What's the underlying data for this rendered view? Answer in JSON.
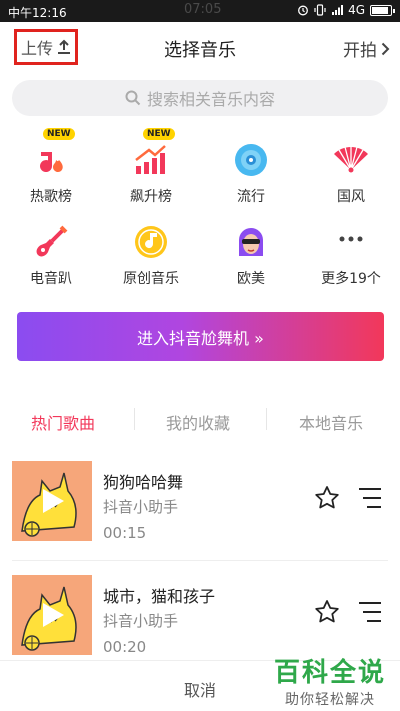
{
  "status_bar": {
    "time": "中午12:16",
    "center_text": "07:05",
    "network": "4G",
    "battery_level": 0.8
  },
  "header": {
    "upload_label": "上传",
    "title": "选择音乐",
    "start_label": "开拍"
  },
  "search": {
    "placeholder": "搜索相关音乐内容"
  },
  "categories": [
    {
      "label": "热歌榜",
      "icon": "hot-chart-icon",
      "badge": "NEW"
    },
    {
      "label": "飙升榜",
      "icon": "rising-chart-icon",
      "badge": "NEW"
    },
    {
      "label": "流行",
      "icon": "vinyl-icon",
      "badge": ""
    },
    {
      "label": "国风",
      "icon": "fan-icon",
      "badge": ""
    },
    {
      "label": "电音趴",
      "icon": "guitar-icon",
      "badge": ""
    },
    {
      "label": "原创音乐",
      "icon": "music-note-icon",
      "badge": ""
    },
    {
      "label": "欧美",
      "icon": "face-icon",
      "badge": ""
    },
    {
      "label": "更多19个",
      "icon": "more-icon",
      "badge": ""
    }
  ],
  "banner": {
    "label": "进入抖音尬舞机 »"
  },
  "tabs": [
    {
      "label": "热门歌曲",
      "active": true
    },
    {
      "label": "我的收藏",
      "active": false
    },
    {
      "label": "本地音乐",
      "active": false
    }
  ],
  "songs": [
    {
      "title": "狗狗哈哈舞",
      "artist": "抖音小助手",
      "duration": "00:15"
    },
    {
      "title": "城市，猫和孩子",
      "artist": "抖音小助手",
      "duration": "00:20"
    }
  ],
  "bottom": {
    "cancel_label": "取消"
  },
  "watermark": {
    "title": "百科全说",
    "subtitle": "助你轻松解决"
  },
  "colors": {
    "accent": "#f2385a",
    "highlight_border": "#e0231e",
    "watermark": "#2fa84a"
  }
}
